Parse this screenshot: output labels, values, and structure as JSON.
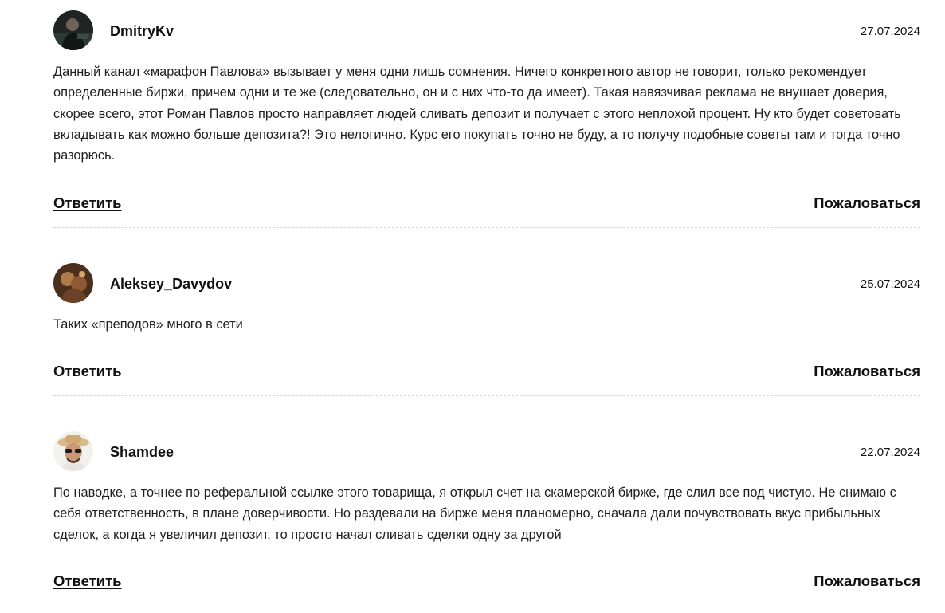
{
  "comments": [
    {
      "username": "DmitryKv",
      "date": "27.07.2024",
      "text": "Данный канал «марафон Павлова» вызывает у меня одни лишь сомнения. Ничего конкретного автор не говорит, только рекомендует определенные биржи, причем одни и те же (следовательно, он и с них что-то да имеет). Такая навязчивая реклама не внушает доверия, скорее всего, этот Роман Павлов просто направляет людей сливать депозит и получает с этого неплохой процент. Ну кто будет советовать вкладывать как можно больше депозита?! Это нелогично. Курс его покупать точно не буду, а то получу подобные советы там и тогда точно разорюсь.",
      "reply_label": "Ответить",
      "report_label": "Пожаловаться"
    },
    {
      "username": "Aleksey_Davydov",
      "date": "25.07.2024",
      "text": "Таких «преподов» много в сети",
      "reply_label": "Ответить",
      "report_label": "Пожаловаться"
    },
    {
      "username": "Shamdee",
      "date": "22.07.2024",
      "text": "По наводке, а точнее по реферальной ссылке этого товарища, я открыл счет на скамерской бирже, где слил все под чистую. Не снимаю с себя ответственность, в плане доверчивости. Но раздевали на бирже меня планомерно, сначала дали почувствовать вкус прибыльных сделок, а когда я увеличил депозит, то просто начал сливать сделки одну за другой",
      "reply_label": "Ответить",
      "report_label": "Пожаловаться"
    }
  ]
}
